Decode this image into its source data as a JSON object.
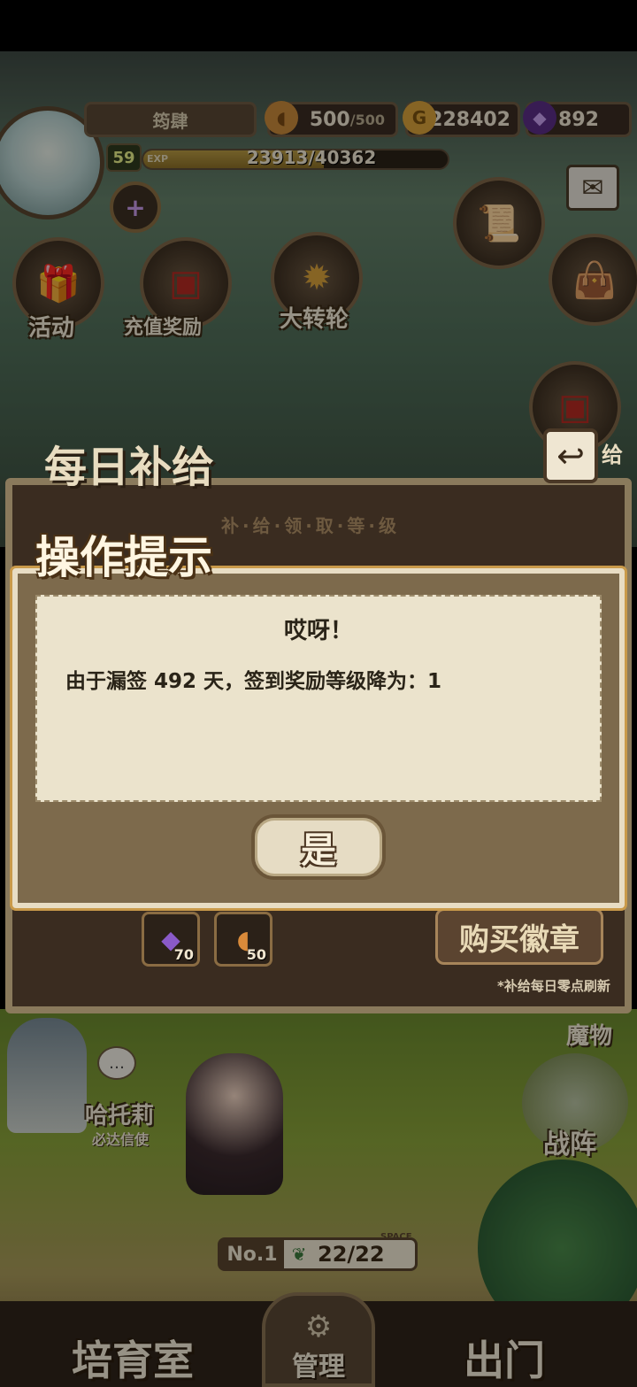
{
  "hud": {
    "player_name": "筠肆",
    "level": "59",
    "exp_label": "EXP",
    "exp_text": "23913/40362",
    "exp_fraction": 0.5925,
    "bread_current": "500",
    "bread_max": "/500",
    "gold": "228402",
    "gems": "892"
  },
  "hub": {
    "activity": "活动",
    "recharge_reward": "充值奖励",
    "big_wheel": "大转轮"
  },
  "daily_panel": {
    "title": "每日补给",
    "subtitle": "补·给·领·取·等·级",
    "slots": [
      {
        "icon": "gem-icon",
        "count": "70"
      },
      {
        "icon": "bread-icon",
        "count": "50"
      }
    ],
    "buy_badge": "购买徽章",
    "refresh_note": "*补给每日零点刷新",
    "side_label": "给"
  },
  "dialog": {
    "title": "操作提示",
    "heading": "哎呀！",
    "message": "由于漏签 492 天，签到奖励等级降为：1",
    "confirm": "是"
  },
  "scene": {
    "npc_name": "哈托莉",
    "npc_title": "必达信使",
    "monster_label": "魔物",
    "formation_label": "战阵",
    "no_label": "No.1",
    "space_tag": "SPACE",
    "space_count": "22/22"
  },
  "nav": {
    "training_room": "培育室",
    "manage": "管理",
    "go_out": "出门"
  }
}
